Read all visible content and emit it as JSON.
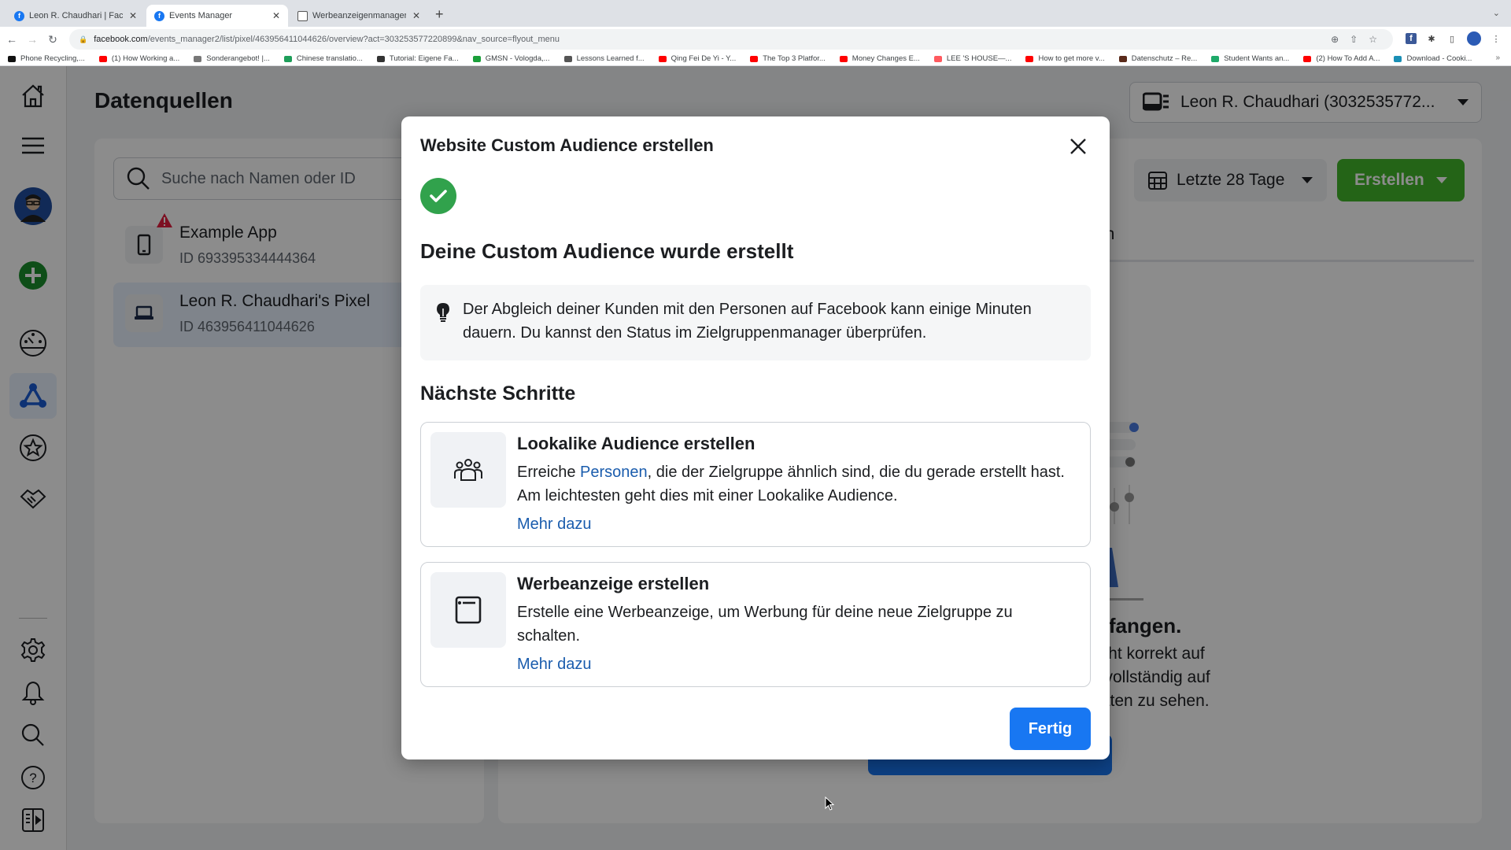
{
  "browser": {
    "tabs": [
      {
        "label": "Leon R. Chaudhari | Facebook",
        "icon": "facebook-icon",
        "active": false
      },
      {
        "label": "Events Manager",
        "icon": "facebook-icon",
        "active": true
      },
      {
        "label": "Werbeanzeigenmanager - Wer",
        "icon": "document-icon",
        "active": false
      }
    ],
    "new_tab_label": "+",
    "url_domain": "facebook.com",
    "url_path": "/events_manager2/list/pixel/463956411044626/overview?act=303253577220899&nav_source=flyout_menu",
    "bookmarks": [
      {
        "label": "Phone Recycling,...",
        "color": "#111111"
      },
      {
        "label": "(1) How Working a...",
        "color": "#ff0000"
      },
      {
        "label": "Sonderangebot! |...",
        "color": "#777777"
      },
      {
        "label": "Chinese translatio...",
        "color": "#1e9e5a"
      },
      {
        "label": "Tutorial: Eigene Fa...",
        "color": "#333333"
      },
      {
        "label": "GMSN - Vologda,...",
        "color": "#1a9f3a"
      },
      {
        "label": "Lessons Learned f...",
        "color": "#555555"
      },
      {
        "label": "Qing Fei De Yi - Y...",
        "color": "#ff0000"
      },
      {
        "label": "The Top 3 Platfor...",
        "color": "#ff0000"
      },
      {
        "label": "Money Changes E...",
        "color": "#ff0000"
      },
      {
        "label": "LEE 'S HOUSE—...",
        "color": "#ff5a5f"
      },
      {
        "label": "How to get more v...",
        "color": "#ff0000"
      },
      {
        "label": "Datenschutz – Re...",
        "color": "#5a2a1a"
      },
      {
        "label": "Student Wants an...",
        "color": "#1eaa6a"
      },
      {
        "label": "(2) How To Add A...",
        "color": "#ff0000"
      },
      {
        "label": "Download - Cooki...",
        "color": "#1a8fb5"
      }
    ],
    "bookmarks_more": "»"
  },
  "app": {
    "page_title": "Datenquellen",
    "account_selector": "Leon R. Chaudhari (3032535772...",
    "search_placeholder": "Suche nach Namen oder ID",
    "data_sources": [
      {
        "name": "Example App",
        "id": "ID 693395334444364",
        "type": "app",
        "warning": true,
        "selected": false
      },
      {
        "name": "Leon R. Chaudhari's Pixel",
        "id": "ID 463956411044626",
        "type": "pixel",
        "warning": false,
        "selected": true
      }
    ],
    "date_range": "Letzte 28 Tage",
    "create_button": "Erstellen",
    "tab_partial": "en",
    "empty_title_partial": "pfangen.",
    "empty_body_partial": [
      "icht korrekt auf",
      "l vollständig auf",
      "täten zu sehen."
    ]
  },
  "modal": {
    "title": "Website Custom Audience erstellen",
    "success_title": "Deine Custom Audience wurde erstellt",
    "info_text": "Der Abgleich deiner Kunden mit den Personen auf Facebook kann einige Minuten dauern. Du kannst den Status im Zielgruppenmanager überprüfen.",
    "next_steps_title": "Nächste Schritte",
    "steps": [
      {
        "title": "Lookalike Audience erstellen",
        "desc_before": "Erreiche ",
        "desc_link": "Personen",
        "desc_after": ", die der Zielgruppe ähnlich sind, die du gerade erstellt hast. Am leichtesten geht dies mit einer Lookalike Audience.",
        "more": "Mehr dazu"
      },
      {
        "title": "Werbeanzeige erstellen",
        "desc": "Erstelle eine Werbeanzeige, um Werbung für deine neue Zielgruppe zu schalten.",
        "more": "Mehr dazu"
      }
    ],
    "done_button": "Fertig"
  },
  "colors": {
    "primary_blue": "#1877f2",
    "link_blue": "#1a5cad",
    "success_green": "#31a24c",
    "create_green": "#42b72a",
    "warning_red": "#e41e3f"
  }
}
